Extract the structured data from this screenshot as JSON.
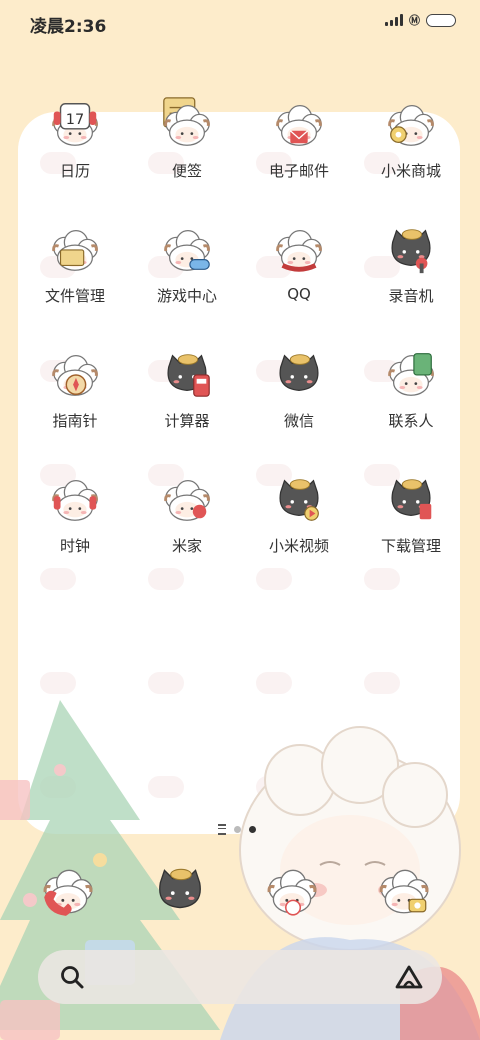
{
  "status_bar": {
    "time": "凌晨2:36",
    "network": "Ⓜ"
  },
  "apps": [
    {
      "label": "日历",
      "icon": "calendar-icon"
    },
    {
      "label": "便签",
      "icon": "notes-icon"
    },
    {
      "label": "电子邮件",
      "icon": "email-icon"
    },
    {
      "label": "小米商城",
      "icon": "mi-store-icon"
    },
    {
      "label": "文件管理",
      "icon": "file-manager-icon"
    },
    {
      "label": "游戏中心",
      "icon": "game-center-icon"
    },
    {
      "label": "QQ",
      "icon": "qq-icon"
    },
    {
      "label": "录音机",
      "icon": "recorder-icon"
    },
    {
      "label": "指南针",
      "icon": "compass-icon"
    },
    {
      "label": "计算器",
      "icon": "calculator-icon"
    },
    {
      "label": "微信",
      "icon": "wechat-icon"
    },
    {
      "label": "联系人",
      "icon": "contacts-icon"
    },
    {
      "label": "时钟",
      "icon": "clock-icon"
    },
    {
      "label": "米家",
      "icon": "mijia-icon"
    },
    {
      "label": "小米视频",
      "icon": "mi-video-icon"
    },
    {
      "label": "下载管理",
      "icon": "downloads-icon"
    }
  ],
  "calendar_day": "17",
  "dock": [
    {
      "name": "phone-icon"
    },
    {
      "name": "messages-icon"
    },
    {
      "name": "browser-icon"
    },
    {
      "name": "camera-icon"
    }
  ],
  "page_indicator": {
    "pages": 2,
    "current": 2
  },
  "colors": {
    "background": "#fdeccb",
    "card": "#ffffff",
    "sheep": "#ffffff",
    "cat": "#4a4a4a",
    "accent": "#e05555"
  }
}
